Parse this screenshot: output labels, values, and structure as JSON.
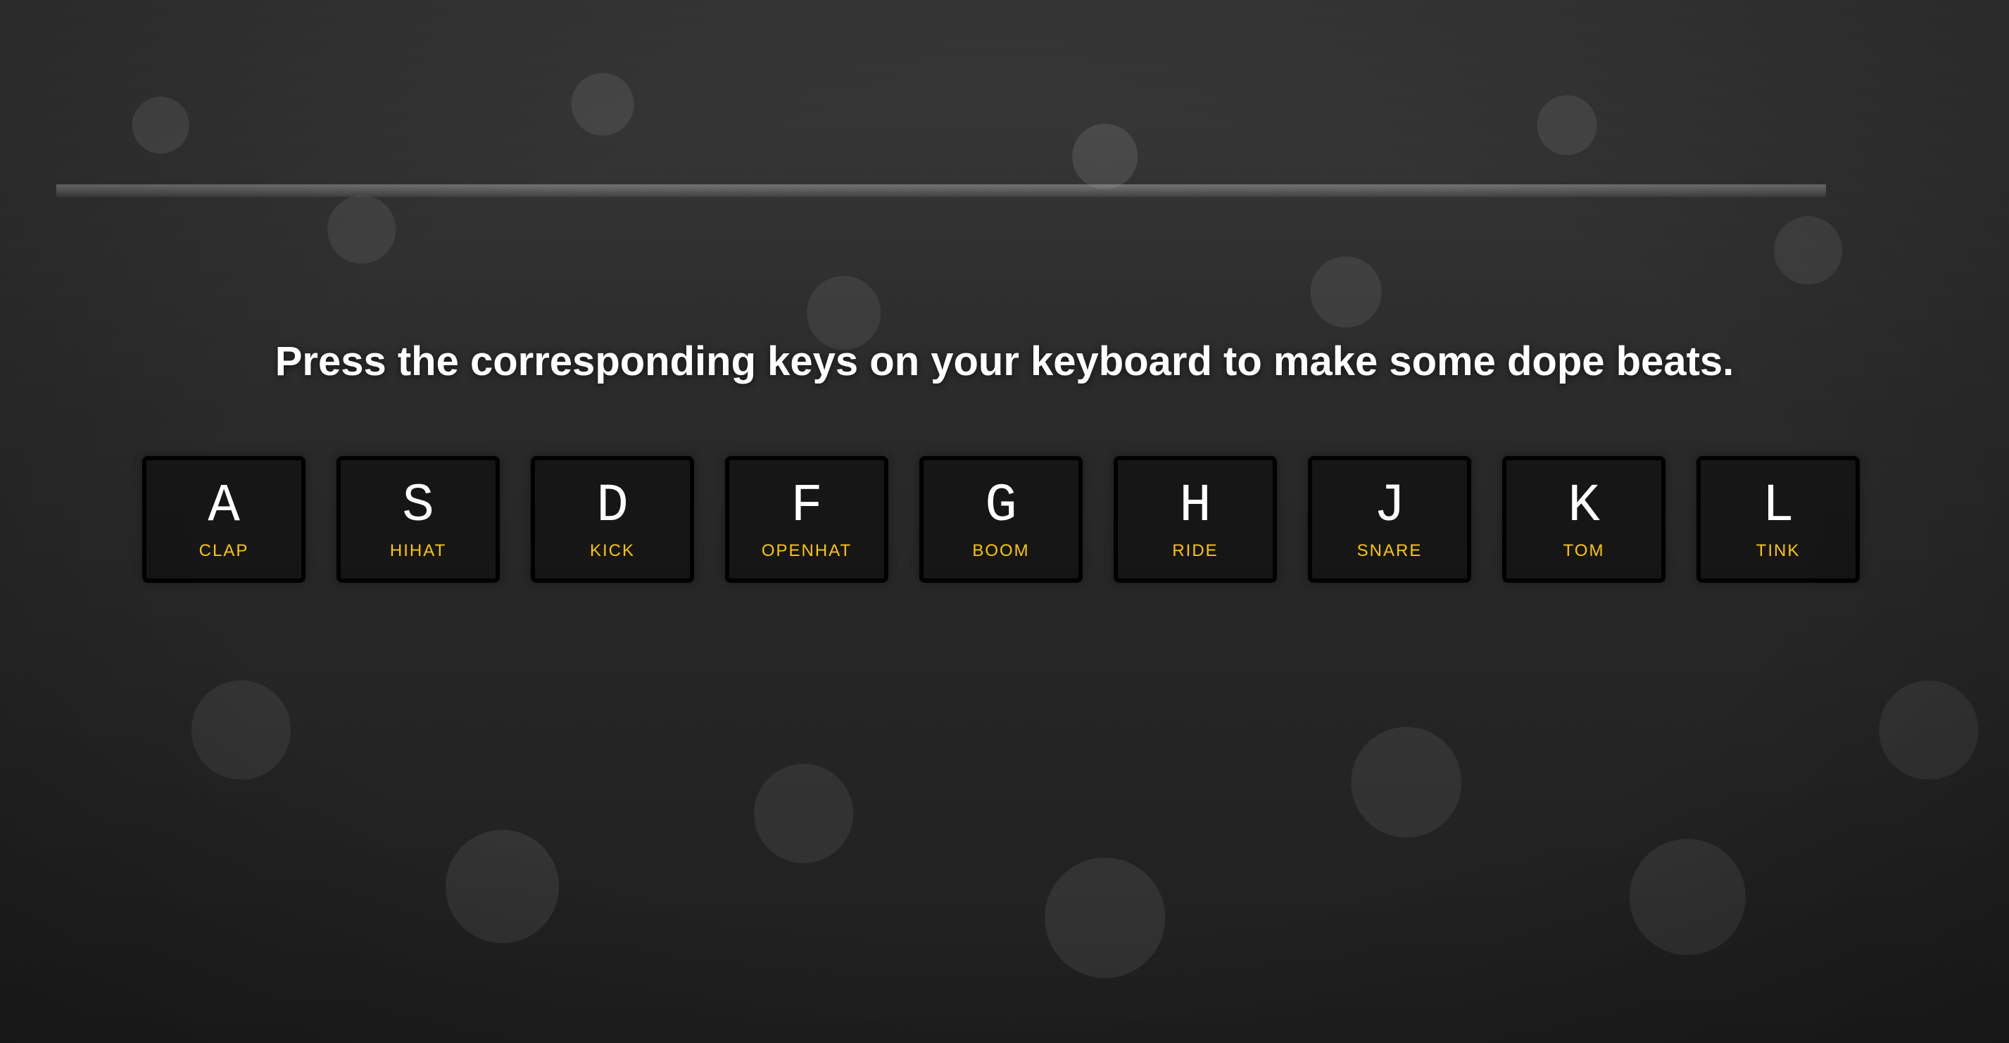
{
  "headline": "Press the corresponding keys on your keyboard to make some dope beats.",
  "accent_color": "#ffc600",
  "keys": [
    {
      "key": "A",
      "sound": "clap"
    },
    {
      "key": "S",
      "sound": "hihat"
    },
    {
      "key": "D",
      "sound": "kick"
    },
    {
      "key": "F",
      "sound": "openhat"
    },
    {
      "key": "G",
      "sound": "boom"
    },
    {
      "key": "H",
      "sound": "ride"
    },
    {
      "key": "J",
      "sound": "snare"
    },
    {
      "key": "K",
      "sound": "tom"
    },
    {
      "key": "L",
      "sound": "tink"
    }
  ]
}
